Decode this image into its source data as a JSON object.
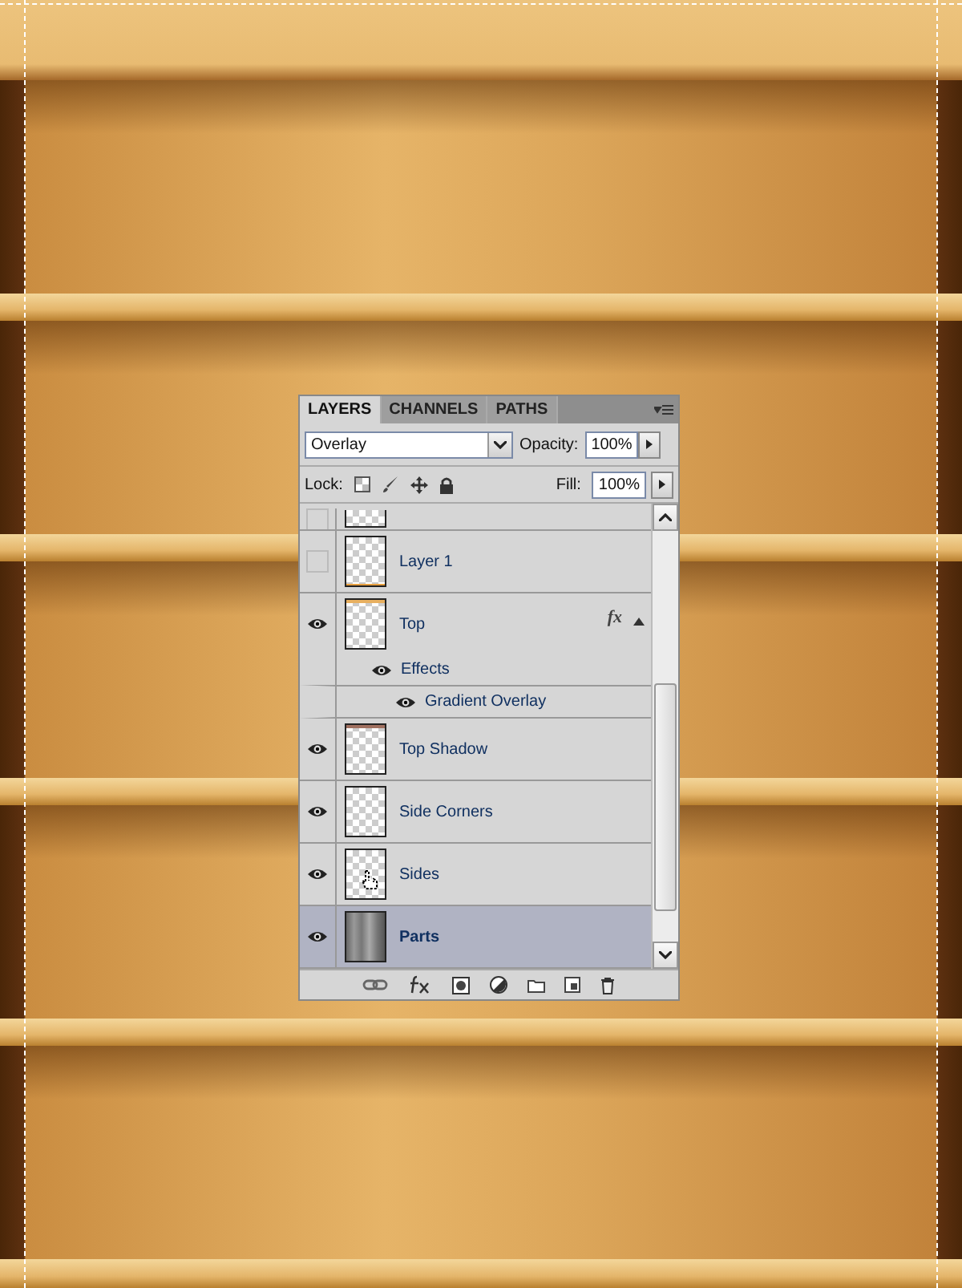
{
  "tabs": [
    {
      "label": "LAYERS",
      "selected": true
    },
    {
      "label": "CHANNELS",
      "selected": false
    },
    {
      "label": "PATHS",
      "selected": false
    }
  ],
  "blend_mode": "Overlay",
  "opacity_label": "Opacity:",
  "opacity": "100%",
  "lock_label": "Lock:",
  "fill_label": "Fill:",
  "fill": "100%",
  "layers": [
    {
      "kind": "plain",
      "visible": false,
      "selected": false
    },
    {
      "kind": "bottomline",
      "name": "Layer 1",
      "visible": false,
      "selected": false
    },
    {
      "kind": "topstrip",
      "name": "Top",
      "visible": true,
      "selected": false,
      "fx_badge": "fx",
      "expanded": true,
      "effects": {
        "label": "Effects",
        "visible": true,
        "children": [
          {
            "name": "Gradient Overlay",
            "visible": true
          }
        ]
      }
    },
    {
      "kind": "shadowstrip",
      "name": "Top Shadow",
      "visible": true,
      "selected": false
    },
    {
      "kind": "plain",
      "name": "Side Corners",
      "visible": true,
      "selected": false
    },
    {
      "kind": "cursor",
      "name": "Sides",
      "visible": true,
      "selected": false
    },
    {
      "kind": "stripes",
      "name": "Parts",
      "visible": true,
      "selected": true
    }
  ]
}
